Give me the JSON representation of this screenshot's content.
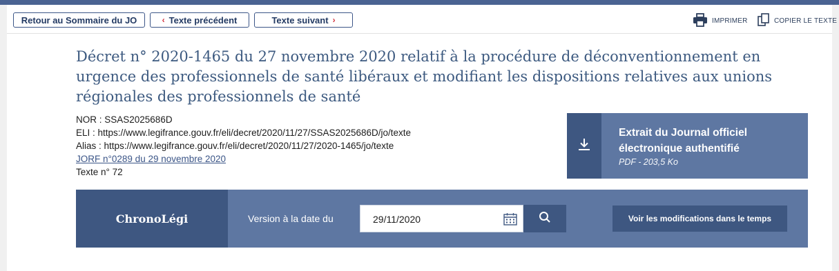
{
  "toolbar": {
    "back_label": "Retour au Sommaire du JO",
    "prev_label": "Texte précédent",
    "prev_chevron": "‹",
    "next_label": "Texte suivant",
    "next_chevron": "›",
    "print_label": "IMPRIMER",
    "copy_label": "COPIER LE TEXTE",
    "print_icon": "printer-icon",
    "copy_icon": "copy-icon"
  },
  "document": {
    "title": "Décret n° 2020-1465 du 27 novembre 2020 relatif à la procédure de déconventionnement en urgence des professionnels de santé libéraux et modifiant les dispositions relatives aux unions régionales des professionnels de santé",
    "nor": "NOR : SSAS2025686D",
    "eli": "ELI : https://www.legifrance.gouv.fr/eli/decret/2020/11/27/SSAS2025686D/jo/texte",
    "alias": "Alias : https://www.legifrance.gouv.fr/eli/decret/2020/11/27/2020-1465/jo/texte",
    "jorf_link": "JORF n°0289 du 29 novembre 2020",
    "text_number": "Texte n° 72"
  },
  "download": {
    "title_line1": "Extrait du Journal officiel",
    "title_line2": "électronique authentifié",
    "subtitle": "PDF - 203,5 Ko",
    "icon": "download-icon"
  },
  "chrono": {
    "brand": "ChronoLégi",
    "version_label": "Version à la date du",
    "date_value": "29/11/2020",
    "calendar_icon": "calendar-icon",
    "search_icon": "search-icon",
    "modifications_label": "Voir les modifications dans le temps"
  },
  "colors": {
    "accent": "#4a6392",
    "panel": "#5e77a2",
    "panel_dark": "#3e5781",
    "title": "#3d5a80",
    "chevron": "#d4303b"
  }
}
